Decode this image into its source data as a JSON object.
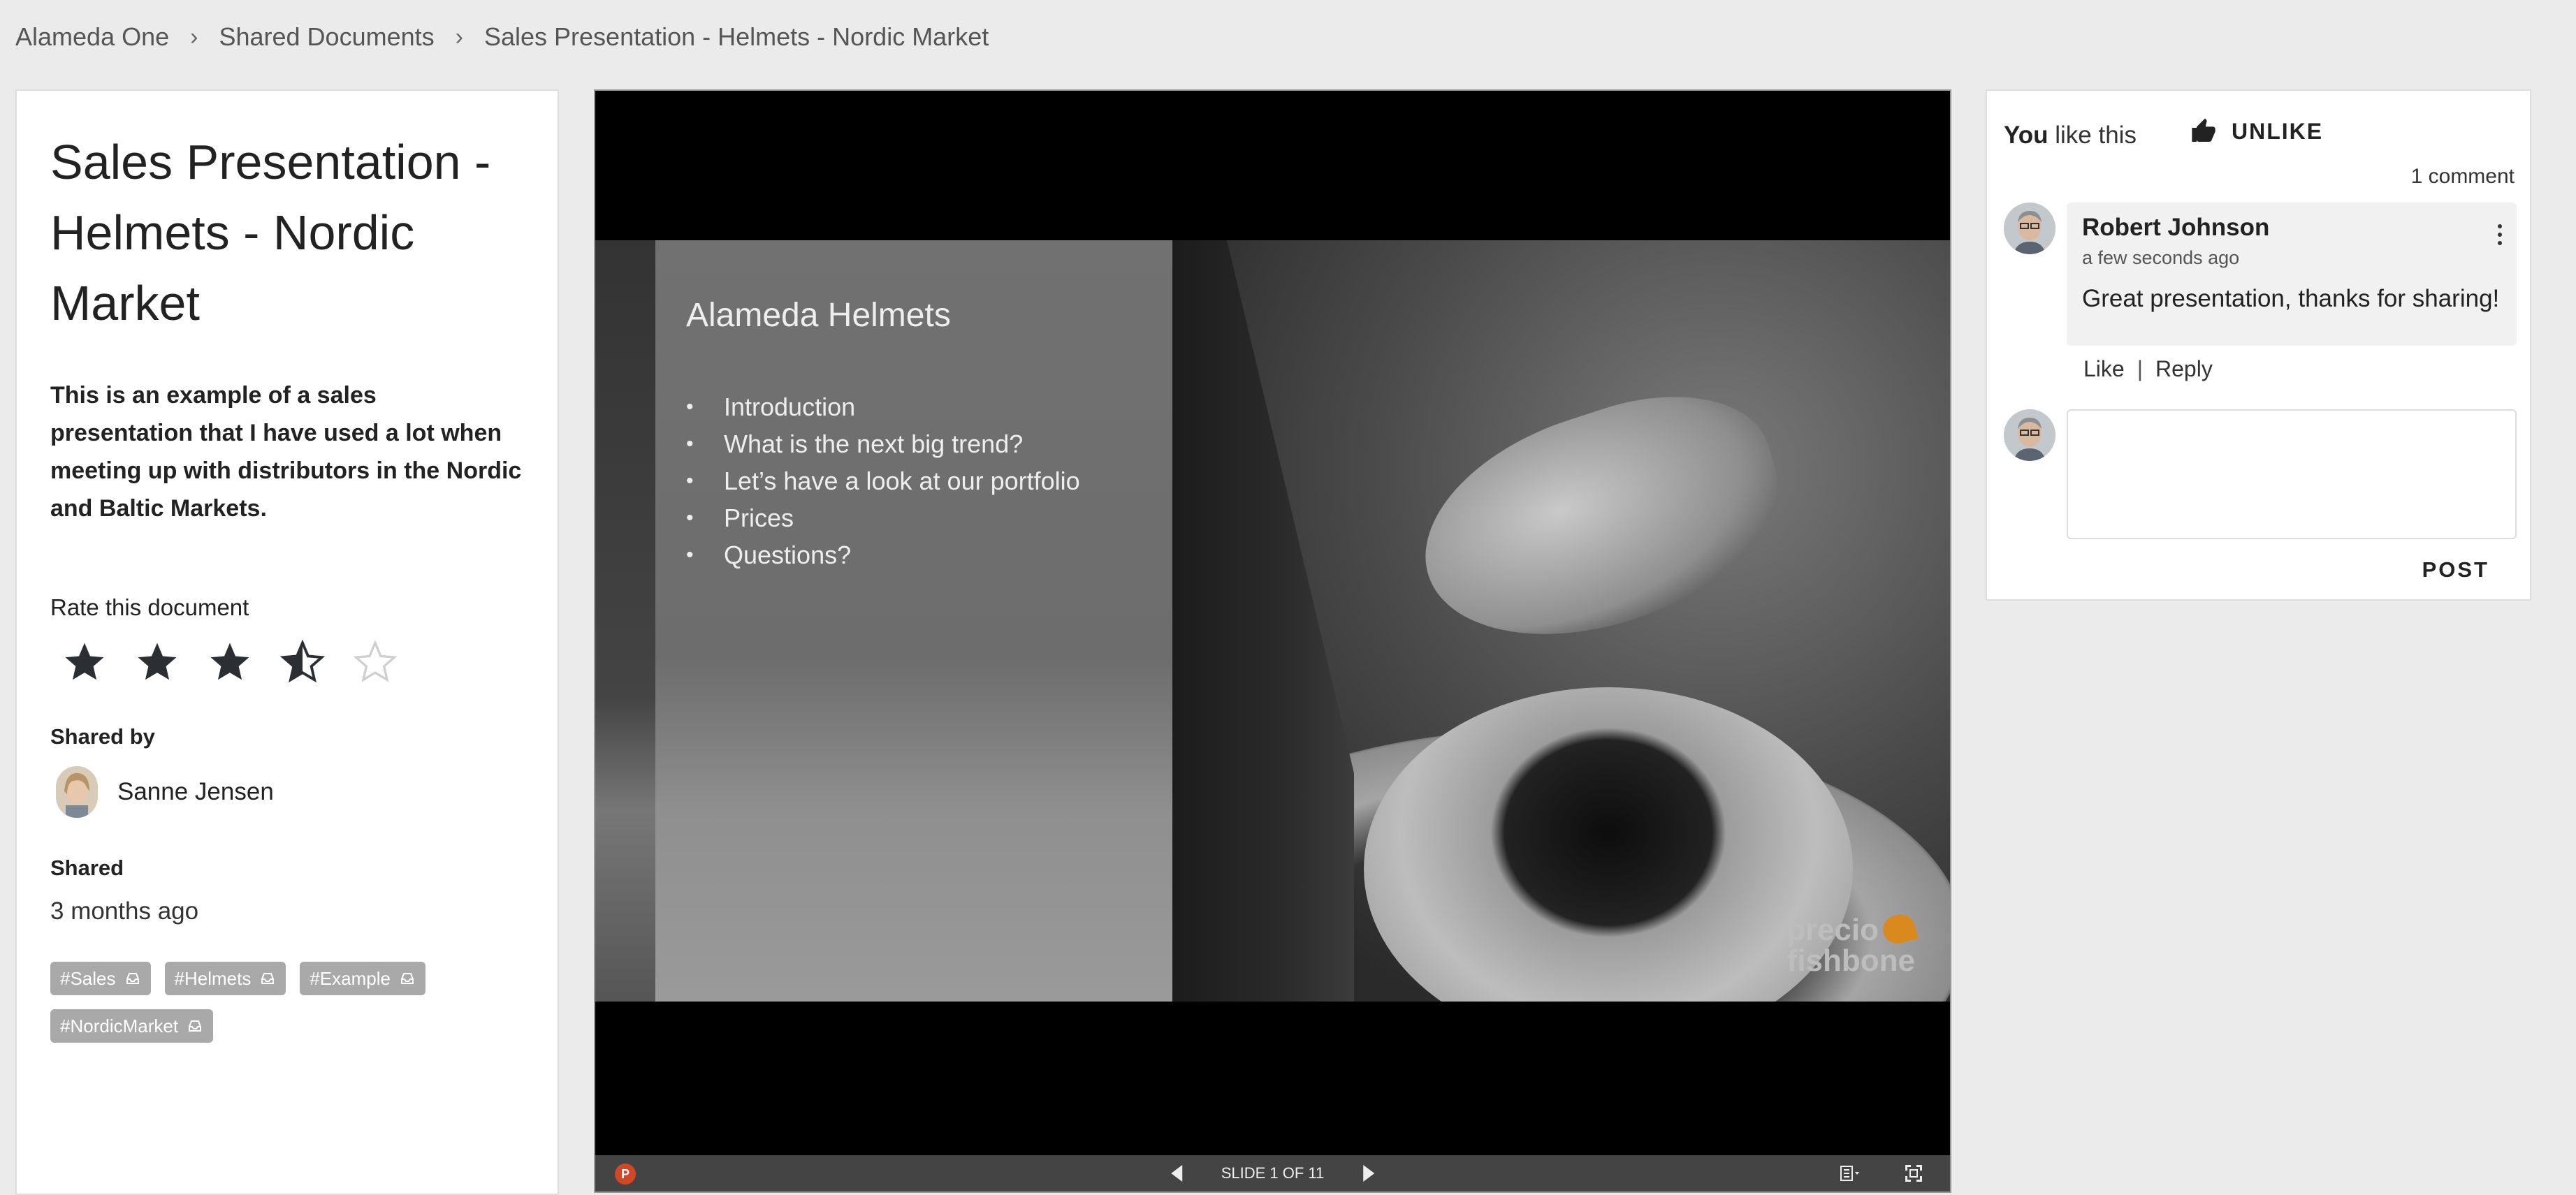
{
  "breadcrumb": {
    "items": [
      "Alameda One",
      "Shared Documents",
      "Sales Presentation - Helmets - Nordic Market"
    ],
    "separator": "›"
  },
  "document": {
    "title": "Sales Presentation - Helmets - Nordic Market",
    "description": "This is an example of a sales presentation that I have used a lot when meeting up with distributors in the Nordic and Baltic Markets.",
    "rate_label": "Rate this document",
    "rating": 3.5,
    "rating_max": 5,
    "shared_by_label": "Shared by",
    "shared_by_name": "Sanne Jensen",
    "shared_label": "Shared",
    "shared_when": "3 months ago",
    "tags": [
      "#Sales",
      "#Helmets",
      "#Example",
      "#NordicMarket"
    ]
  },
  "viewer": {
    "slide_title": "Alameda Helmets",
    "bullets": [
      "Introduction",
      "What is the next big trend?",
      "Let’s have a look at our portfolio",
      "Prices",
      "Questions?"
    ],
    "brand_line1": "precio",
    "brand_line2": "fishbone",
    "slide_counter": "SLIDE 1 OF 11",
    "file_type_icon": "powerpoint-icon"
  },
  "comments": {
    "like_you": "You",
    "like_rest": " like this",
    "unlike_label": "UNLIKE",
    "count_label": "1 comment",
    "items": [
      {
        "author": "Robert Johnson",
        "time": "a few seconds ago",
        "text": "Great presentation, thanks for sharing!",
        "like_label": "Like",
        "reply_label": "Reply"
      }
    ],
    "reply_placeholder": "",
    "post_label": "POST"
  },
  "colors": {
    "star": "#2b2f33",
    "tag_bg": "#a9a9a9",
    "toolbar_bg": "#444444",
    "accent_orange": "#d9891e"
  }
}
